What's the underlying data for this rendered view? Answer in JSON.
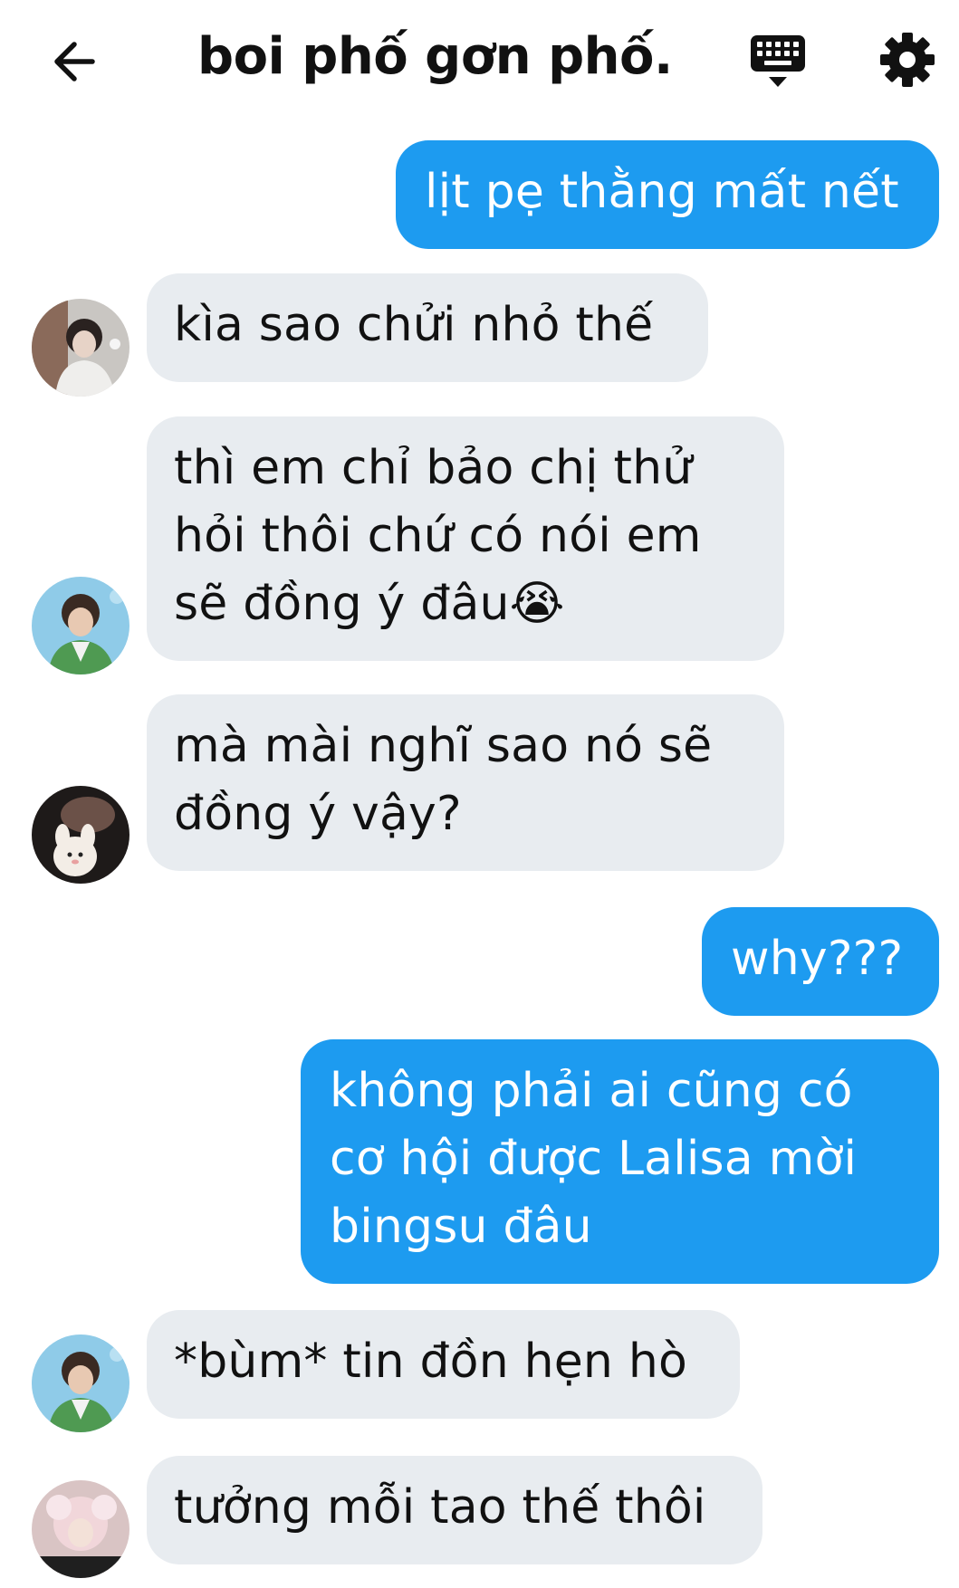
{
  "header": {
    "title": "boi phố gơn phố...",
    "back_icon": "arrow-left-icon",
    "keyboard_icon": "keyboard-icon",
    "settings_icon": "gear-icon"
  },
  "messages": [
    {
      "dir": "out",
      "lines": [
        "lịt pẹ thằng mất nết"
      ]
    },
    {
      "dir": "in",
      "lines": [
        "kìa sao chửi nhỏ thế"
      ]
    },
    {
      "dir": "in",
      "lines": [
        "thì em chỉ bảo chị thử",
        "hỏi thôi chứ có nói em",
        "sẽ đồng ý đâu😭"
      ]
    },
    {
      "dir": "in",
      "lines": [
        "mà mài nghĩ sao nó sẽ",
        "đồng ý vậy?"
      ]
    },
    {
      "dir": "out",
      "lines": [
        "why???"
      ]
    },
    {
      "dir": "out",
      "lines": [
        "không phải ai cũng có",
        "cơ hội được Lalisa mời",
        "bingsu đâu"
      ]
    },
    {
      "dir": "in",
      "lines": [
        "*bùm* tin đồn hẹn hò"
      ]
    },
    {
      "dir": "in",
      "lines": [
        "tưởng mỗi tao thế thôi"
      ]
    }
  ],
  "colors": {
    "outgoing_bubble": "#1d9bf0",
    "incoming_bubble": "#e8ecf0",
    "text_dark": "#111111"
  }
}
